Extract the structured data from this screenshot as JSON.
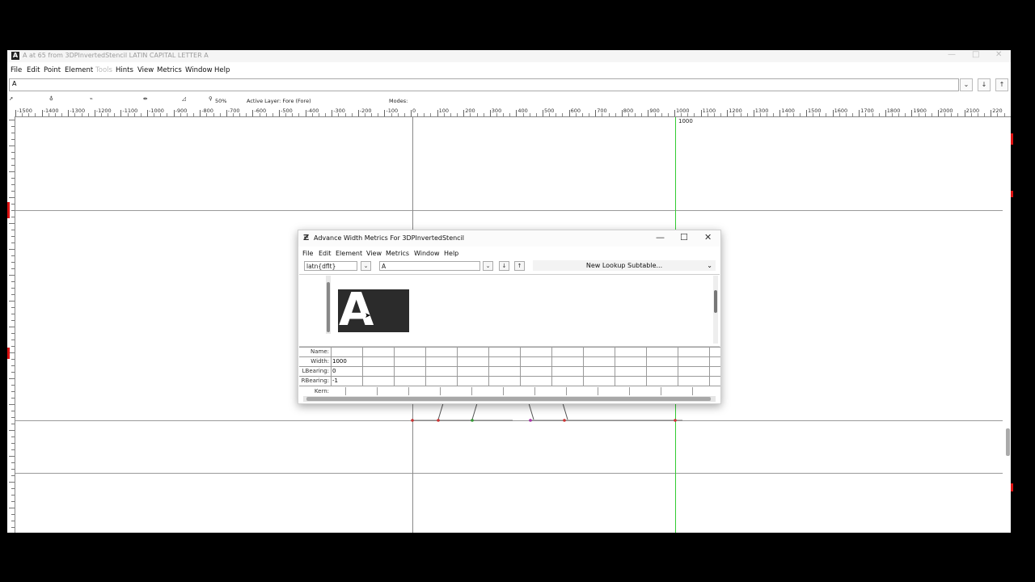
{
  "main_window": {
    "title": "A at 65 from 3DPInvertedStencil LATIN CAPITAL LETTER A",
    "logo": "A",
    "menu": [
      "File",
      "Edit",
      "Point",
      "Element",
      "Tools",
      "Hints",
      "View",
      "Metrics",
      "Window",
      "Help"
    ],
    "glyph_field": "A",
    "toolbar": {
      "zoom": "50%",
      "active_layer": "Active Layer: Fore (Fore)",
      "modes": "Modes:"
    },
    "ruler_ticks": [
      "-1500",
      "-1400",
      "-1300",
      "-1200",
      "-1100",
      "-1000",
      "-900",
      "-800",
      "-700",
      "-600",
      "-500",
      "-400",
      "-300",
      "-200",
      "-100",
      "0",
      "100",
      "200",
      "300",
      "400",
      "500",
      "600",
      "700",
      "800",
      "900",
      "1000",
      "1100",
      "1200",
      "1300",
      "1400",
      "1500",
      "1600",
      "1700",
      "1800",
      "1900",
      "2000",
      "2100",
      "220"
    ],
    "advance_label": "1000"
  },
  "dialog": {
    "icon": "Ƶ",
    "title": "Advance Width Metrics For 3DPInvertedStencil",
    "menu": [
      "File",
      "Edit",
      "Element",
      "View",
      "Metrics",
      "Window",
      "Help"
    ],
    "script_field": "latn{dflt}",
    "glyph_field": "A",
    "lookup_button": "New Lookup Subtable...",
    "preview_glyph": "A",
    "rows": {
      "name_label": "Name:",
      "width_label": "Width:",
      "width_value": "1000",
      "lbearing_label": "LBearing:",
      "lbearing_value": "0",
      "rbearing_label": "RBearing:",
      "rbearing_value": "-1",
      "kern_label": "Kern:"
    }
  },
  "colors": {
    "advance_line": "#33cc33",
    "red_marks": "#dd1111"
  }
}
